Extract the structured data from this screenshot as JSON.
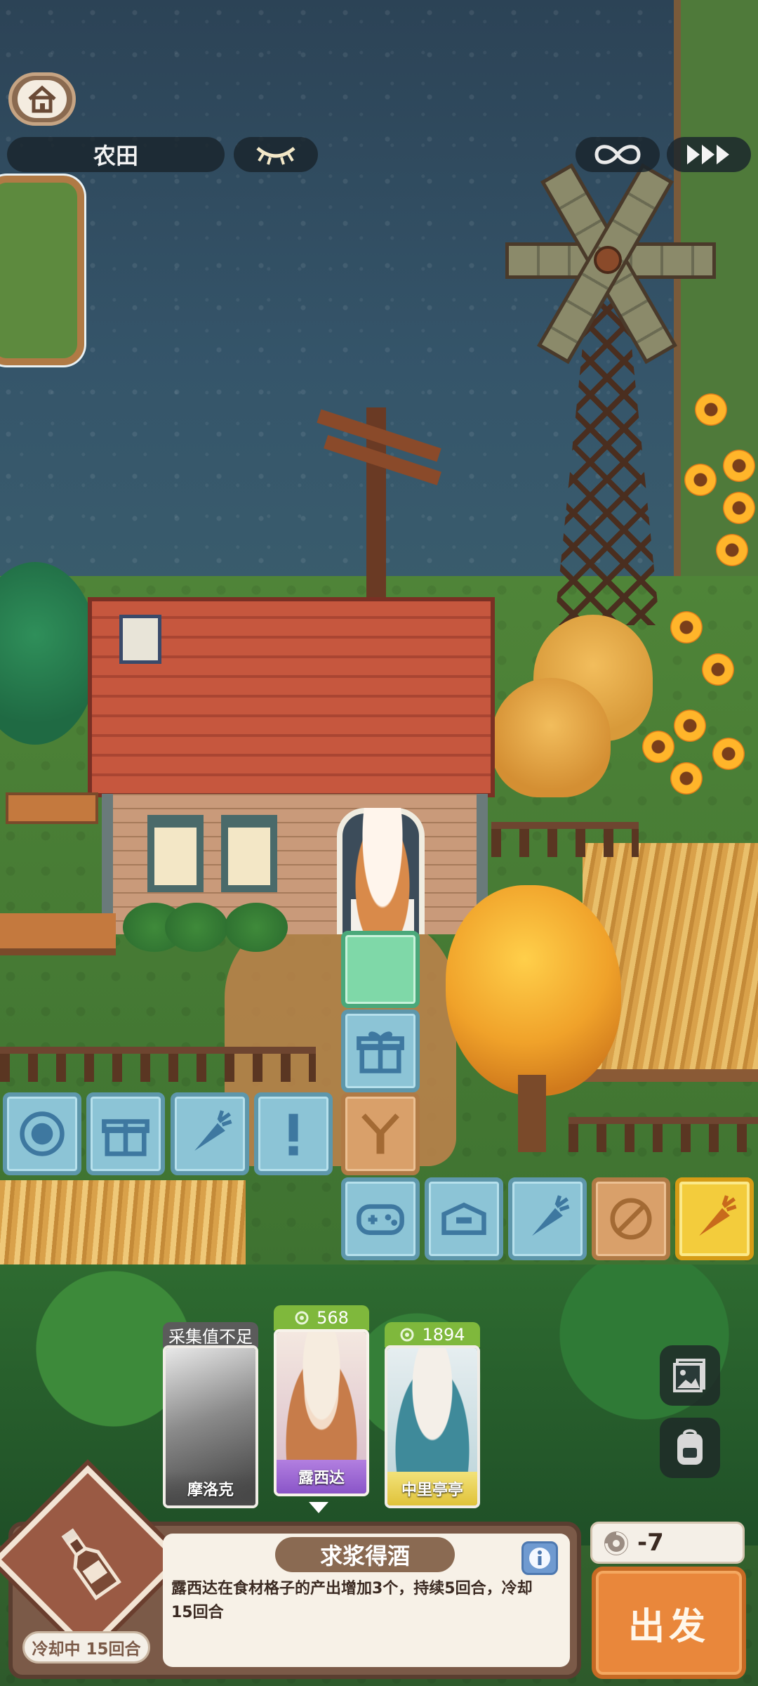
{
  "hud": {
    "location": "农田",
    "home_icon": "home-icon",
    "eye_icon": "closed-eye-icon",
    "loop_icon": "infinity-icon",
    "speed_icon": "fast-forward-icon"
  },
  "board": {
    "tiles": [
      {
        "icon": "gift-icon",
        "style": "blue"
      },
      {
        "icon": "pet-bowl-icon",
        "style": "blue"
      },
      {
        "icon": "gift-icon",
        "style": "blue"
      },
      {
        "icon": "carrot-icon",
        "style": "blue"
      },
      {
        "icon": "exclamation-icon",
        "style": "blue"
      },
      {
        "icon": "slingshot-icon",
        "style": "orange"
      },
      {
        "icon": "gamepad-icon",
        "style": "blue"
      },
      {
        "icon": "toolbox-icon",
        "style": "blue"
      },
      {
        "icon": "carrot-icon",
        "style": "blue"
      },
      {
        "icon": "blocked-icon",
        "style": "orange"
      },
      {
        "icon": "carrot-icon",
        "style": "gold"
      }
    ]
  },
  "characters": [
    {
      "name": "摩洛克",
      "tag": "采集值不足",
      "selected": false
    },
    {
      "name": "露西达",
      "tag": "568",
      "selected": true
    },
    {
      "name": "中里亭亭",
      "tag": "1894",
      "selected": false
    }
  ],
  "side_buttons": {
    "gallery_icon": "picture-icon",
    "bag_icon": "backpack-icon"
  },
  "skill": {
    "icon": "wine-bottle-icon",
    "title": "求浆得酒",
    "description": "露西达在食材格子的产出增加3个，持续5回合，冷却15回合",
    "cooldown": "冷却中 15回合"
  },
  "cost": {
    "value": "-7",
    "icon": "energy-swirl-icon"
  },
  "go_label": "出发",
  "colors": {
    "accent_orange": "#e9873b",
    "tile_blue": "#8cc4d6",
    "tile_gold": "#f3cc3c",
    "panel_brown": "#7b5a48"
  }
}
